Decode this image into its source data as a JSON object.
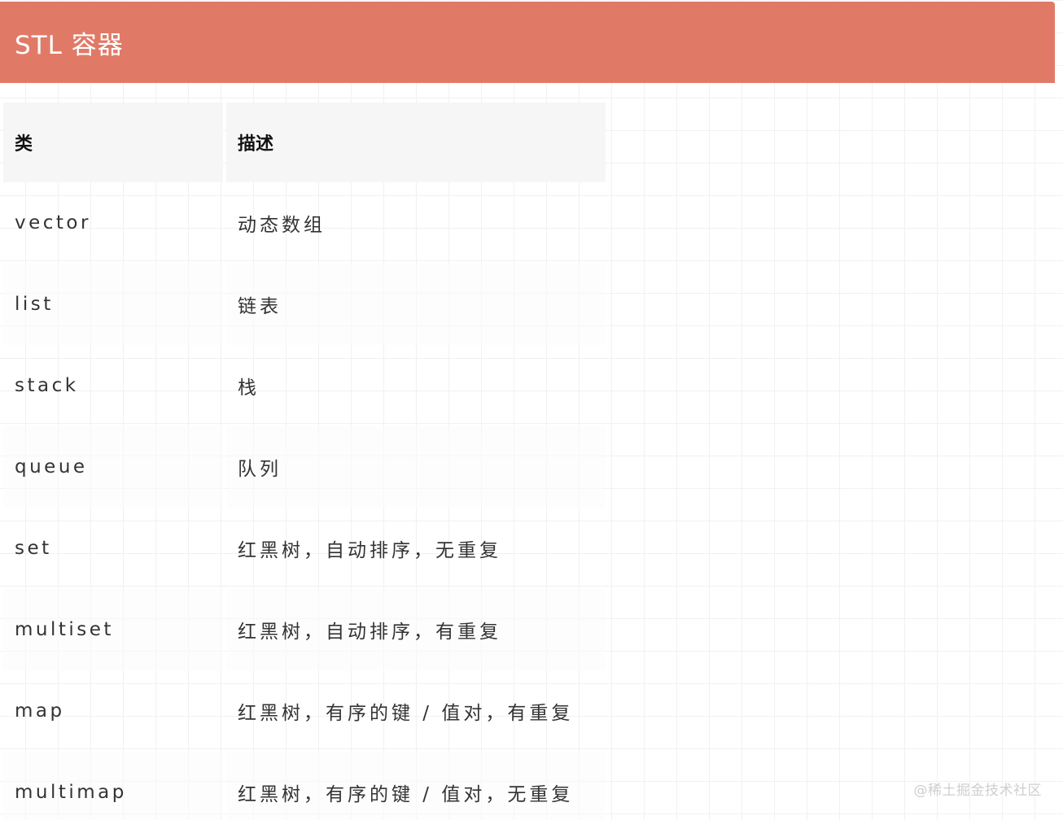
{
  "header": {
    "title": "STL 容器"
  },
  "table": {
    "columns": [
      "类",
      "描述"
    ],
    "rows": [
      {
        "class": "vector",
        "desc": "动态数组"
      },
      {
        "class": "list",
        "desc": "链表"
      },
      {
        "class": "stack",
        "desc": "栈"
      },
      {
        "class": "queue",
        "desc": "队列"
      },
      {
        "class": "set",
        "desc": "红黑树，自动排序，无重复"
      },
      {
        "class": "multiset",
        "desc": "红黑树，自动排序，有重复"
      },
      {
        "class": "map",
        "desc": "红黑树，有序的键 / 值对，有重复"
      },
      {
        "class": "multimap",
        "desc": "红黑树，有序的键 / 值对，无重复"
      }
    ]
  },
  "watermark": "@稀土掘金技术社区",
  "colors": {
    "header_bg": "#e07a67",
    "header_text": "#ffffff"
  }
}
